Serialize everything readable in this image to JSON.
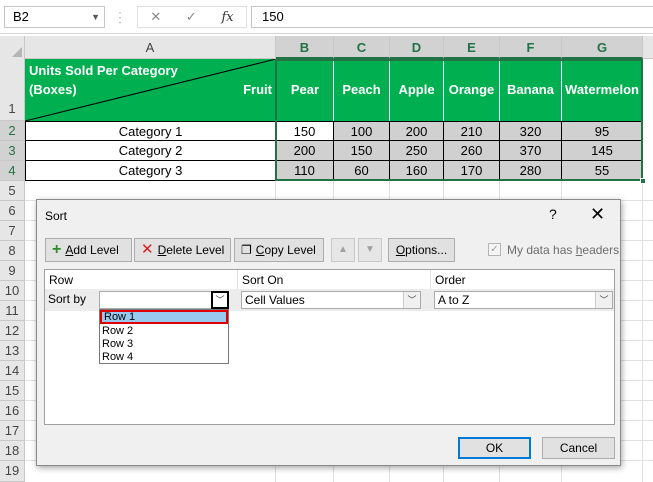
{
  "formula_bar": {
    "name_box": "B2",
    "cancel_icon": "✕",
    "enter_icon": "✓",
    "fx": "fx",
    "value": "150"
  },
  "columns": [
    "A",
    "B",
    "C",
    "D",
    "E",
    "F",
    "G"
  ],
  "rows": [
    "1",
    "2",
    "3",
    "4",
    "5",
    "6",
    "7",
    "8",
    "9",
    "10",
    "11",
    "12",
    "13",
    "14",
    "15",
    "16",
    "17",
    "18",
    "19"
  ],
  "sheet": {
    "header_line1": "Units Sold Per Category",
    "header_line2": "(Boxes)",
    "header_right": "Fruit",
    "fruits": [
      "Pear",
      "Peach",
      "Apple",
      "Orange",
      "Banana",
      "Watermelon"
    ],
    "categories": [
      "Category 1",
      "Category 2",
      "Category 3"
    ],
    "values": [
      [
        "150",
        "100",
        "200",
        "210",
        "320",
        "95"
      ],
      [
        "200",
        "150",
        "250",
        "260",
        "370",
        "145"
      ],
      [
        "110",
        "60",
        "160",
        "170",
        "280",
        "55"
      ]
    ]
  },
  "dialog": {
    "title": "Sort",
    "help": "?",
    "close": "✕",
    "add_level": {
      "pre": "",
      "u": "A",
      "post": "dd Level"
    },
    "delete_level": {
      "pre": "",
      "u": "D",
      "post": "elete Level"
    },
    "copy_level": {
      "pre": "",
      "u": "C",
      "post": "opy Level"
    },
    "options": {
      "pre": "",
      "u": "O",
      "post": "ptions..."
    },
    "headers_check": {
      "pre": "My data has ",
      "u": "h",
      "post": "eaders"
    },
    "col_row": "Row",
    "col_sort_on": "Sort On",
    "col_order": "Order",
    "sort_by": "Sort by",
    "row_value": "",
    "sort_on_value": "Cell Values",
    "order_value": "A to Z",
    "dropdown_options": [
      "Row 1",
      "Row 2",
      "Row 3",
      "Row 4"
    ],
    "ok": "OK",
    "cancel": "Cancel"
  },
  "colors": {
    "header_green": "#00b050",
    "selection_green": "#217346",
    "highlight_red": "#e00000",
    "highlight_blue": "#99c9ef"
  }
}
